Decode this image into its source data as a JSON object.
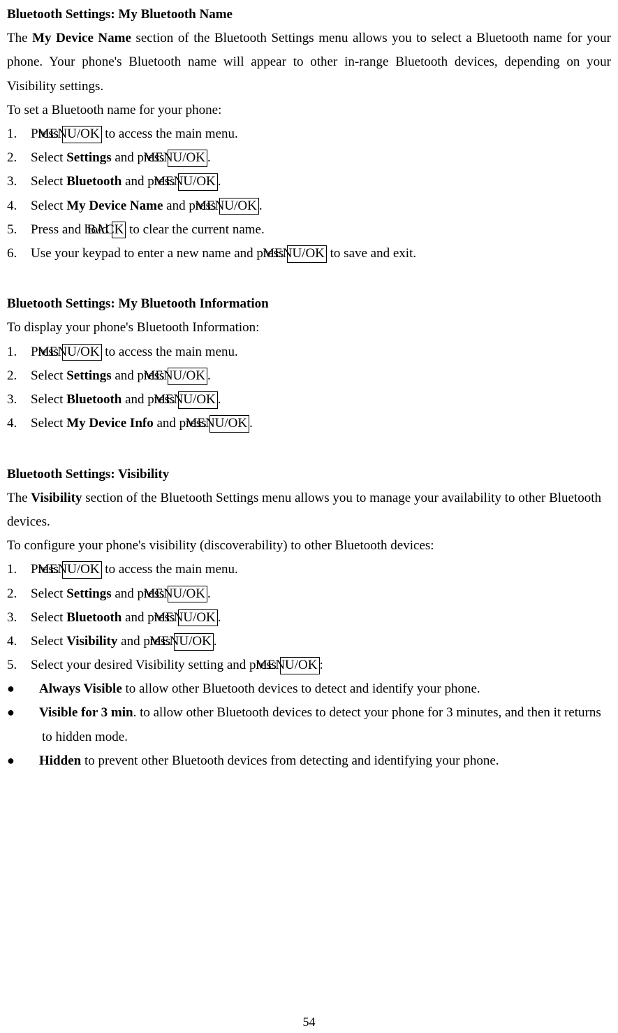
{
  "section1": {
    "heading": "Bluetooth Settings: My Bluetooth Name",
    "intro_pre": "The ",
    "intro_bold": "My Device Name",
    "intro_post": " section of the Bluetooth Settings menu allows you to select a Bluetooth name for your phone. Your phone's Bluetooth name will appear to other in-range Bluetooth devices, depending on your Visibility settings.",
    "lead": "To set a Bluetooth name for your phone:",
    "steps": {
      "s1_pre": "Press ",
      "s1_box": "MENU/OK",
      "s1_post": " to access the main menu.",
      "s2_pre": "Select ",
      "s2_bold": "Settings",
      "s2_mid": " and press ",
      "s2_box": "MENU/OK",
      "s2_post": ".",
      "s3_pre": "Select ",
      "s3_bold": "Bluetooth",
      "s3_mid": " and press ",
      "s3_box": "MENU/OK",
      "s3_post": ".",
      "s4_pre": "Select ",
      "s4_bold": "My Device Name",
      "s4_mid": " and press ",
      "s4_box": "MENU/OK",
      "s4_post": ".",
      "s5_pre": "Press and hold ",
      "s5_box": "BACK",
      "s5_post": " to clear the current name.",
      "s6_pre": "Use your keypad to enter a new name and press ",
      "s6_box": "MENU/OK",
      "s6_post": " to save and exit."
    }
  },
  "section2": {
    "heading": "Bluetooth Settings: My Bluetooth Information",
    "lead": "To display your phone's Bluetooth Information:",
    "steps": {
      "s1_pre": "Press ",
      "s1_box": "MENU/OK",
      "s1_post": " to access the main menu.",
      "s2_pre": "Select ",
      "s2_bold": "Settings",
      "s2_mid": " and press ",
      "s2_box": "MENU/OK",
      "s2_post": ".",
      "s3_pre": "Select ",
      "s3_bold": "Bluetooth",
      "s3_mid": " and press ",
      "s3_box": "MENU/OK",
      "s3_post": ".",
      "s4_pre": "Select ",
      "s4_bold": "My Device Info",
      "s4_mid": " and press ",
      "s4_box": "MENU/OK",
      "s4_post": "."
    }
  },
  "section3": {
    "heading": "Bluetooth Settings: Visibility",
    "intro_pre": "The ",
    "intro_bold": "Visibility",
    "intro_post": " section of the Bluetooth Settings menu allows you to manage your availability to other Bluetooth devices.",
    "lead": "To configure your phone's visibility (discoverability) to other Bluetooth devices:",
    "steps": {
      "s1_pre": "Press ",
      "s1_box": "MENU/OK",
      "s1_post": " to access the main menu.",
      "s2_pre": "Select ",
      "s2_bold": "Settings",
      "s2_mid": " and press ",
      "s2_box": "MENU/OK",
      "s2_post": ".",
      "s3_pre": "Select ",
      "s3_bold": "Bluetooth",
      "s3_mid": " and press ",
      "s3_box": "MENU/OK",
      "s3_post": ".",
      "s4_pre": "Select ",
      "s4_bold": "Visibility",
      "s4_mid": " and press ",
      "s4_box": "MENU/OK",
      "s4_post": ".",
      "s5_pre": "Select your desired Visibility setting and press ",
      "s5_box": "MENU/OK",
      "s5_post": ":"
    },
    "bullets": {
      "b1_bold": "Always Visible",
      "b1_post": " to allow other Bluetooth devices to detect and identify your phone.",
      "b2_bold": "Visible for 3 min",
      "b2_post": ". to allow other Bluetooth devices to detect your phone for 3 minutes, and then it returns to hidden mode.",
      "b3_bold": "Hidden",
      "b3_post": " to prevent other Bluetooth devices from detecting and identifying your phone."
    }
  },
  "page_number": "54"
}
